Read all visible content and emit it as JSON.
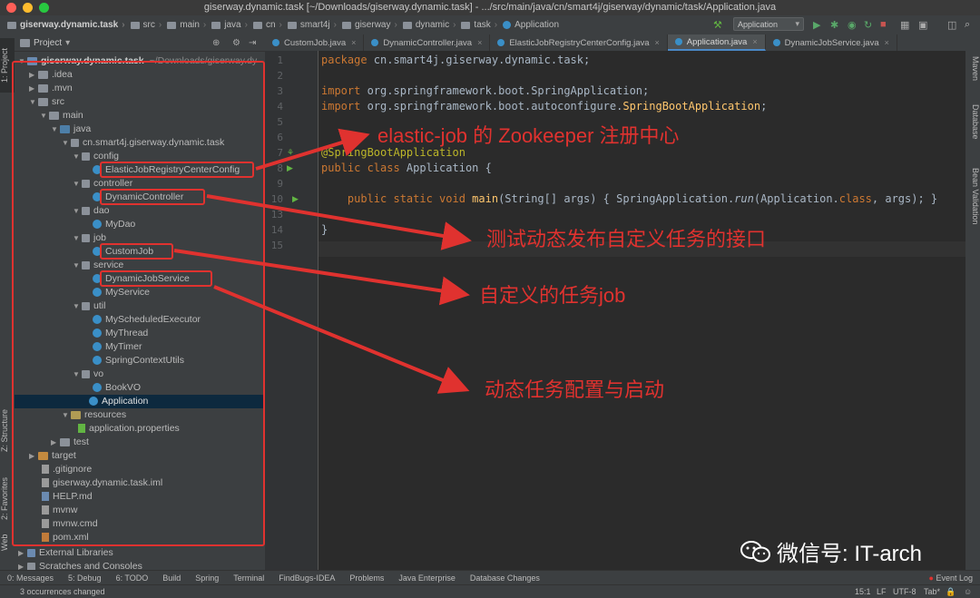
{
  "window": {
    "title": "giserway.dynamic.task [~/Downloads/giserway.dynamic.task] - .../src/main/java/cn/smart4j/giserway/dynamic/task/Application.java"
  },
  "breadcrumbs": [
    "giserway.dynamic.task",
    "src",
    "main",
    "java",
    "cn",
    "smart4j",
    "giserway",
    "dynamic",
    "task",
    "Application"
  ],
  "run_config": "Application",
  "project_panel": {
    "header": "Project"
  },
  "left_tabs": [
    "1: Project",
    "Z: Structure",
    "2: Favorites",
    "Web"
  ],
  "right_tabs": [
    "Maven",
    "Database",
    "Bean Validation"
  ],
  "tree": {
    "root": "giserway.dynamic.task",
    "root_hint": "~/Downloads/giserway.dy",
    "idea": ".idea",
    "mvn": ".mvn",
    "src": "src",
    "main": "main",
    "java": "java",
    "pkg": "cn.smart4j.giserway.dynamic.task",
    "config": "config",
    "config_cls": "ElasticJobRegistryCenterConfig",
    "controller": "controller",
    "controller_cls": "DynamicController",
    "dao": "dao",
    "dao_cls": "MyDao",
    "job": "job",
    "job_cls": "CustomJob",
    "service": "service",
    "service_cls1": "DynamicJobService",
    "service_cls2": "MyService",
    "util": "util",
    "util1": "MyScheduledExecutor",
    "util2": "MyThread",
    "util3": "MyTimer",
    "util4": "SpringContextUtils",
    "vo": "vo",
    "vo_cls": "BookVO",
    "application": "Application",
    "resources": "resources",
    "res_file": "application.properties",
    "test": "test",
    "target": "target",
    "gitignore": ".gitignore",
    "iml": "giserway.dynamic.task.iml",
    "help": "HELP.md",
    "mvnw": "mvnw",
    "mvnwcmd": "mvnw.cmd",
    "pom": "pom.xml",
    "extlib": "External Libraries",
    "scratches": "Scratches and Consoles"
  },
  "tabs": [
    {
      "label": "CustomJob.java"
    },
    {
      "label": "DynamicController.java"
    },
    {
      "label": "ElasticJobRegistryCenterConfig.java"
    },
    {
      "label": "Application.java"
    },
    {
      "label": "DynamicJobService.java"
    }
  ],
  "code": {
    "l1a": "package",
    "l1b": " cn.smart4j.giserway.dynamic.task;",
    "l3a": "import",
    "l3b": " org.springframework.boot.SpringApplication;",
    "l4a": "import",
    "l4b": " org.springframework.boot.autoconfigure.",
    "l4c": "SpringBootApplication",
    "l4d": ";",
    "l7": "@SpringBootApplication",
    "l8a": "public class",
    "l8b": " Application {",
    "l10a": "    public static void",
    "l10b": " main",
    "l10c": "(String[] args) { SpringApplication.",
    "l10d": "run",
    "l10e": "(Application.",
    "l10f": "class",
    "l10g": ", args); }",
    "l14": "}"
  },
  "line_numbers": [
    "1",
    "2",
    "3",
    "4",
    "5",
    "6",
    "7",
    "8",
    "9",
    "10",
    "13",
    "14",
    "15"
  ],
  "annotations": {
    "a1": "elastic-job 的 Zookeeper 注册中心",
    "a2": "测试动态发布自定义任务的接口",
    "a3": "自定义的任务job",
    "a4": "动态任务配置与启动"
  },
  "tool_windows": [
    "0: Messages",
    "5: Debug",
    "6: TODO",
    "Build",
    "Spring",
    "Terminal",
    "FindBugs-IDEA",
    "Problems",
    "Java Enterprise",
    "Database Changes",
    "Event Log"
  ],
  "status": {
    "message": "3 occurrences changed",
    "pos": "15:1",
    "lf": "LF",
    "enc": "UTF-8",
    "tab": "Tab*"
  },
  "watermark": "微信号: IT-arch",
  "colors": {
    "red": "#e0322f",
    "bg": "#2b2b2b",
    "panel": "#3c3f41",
    "selection": "#0d293e"
  }
}
